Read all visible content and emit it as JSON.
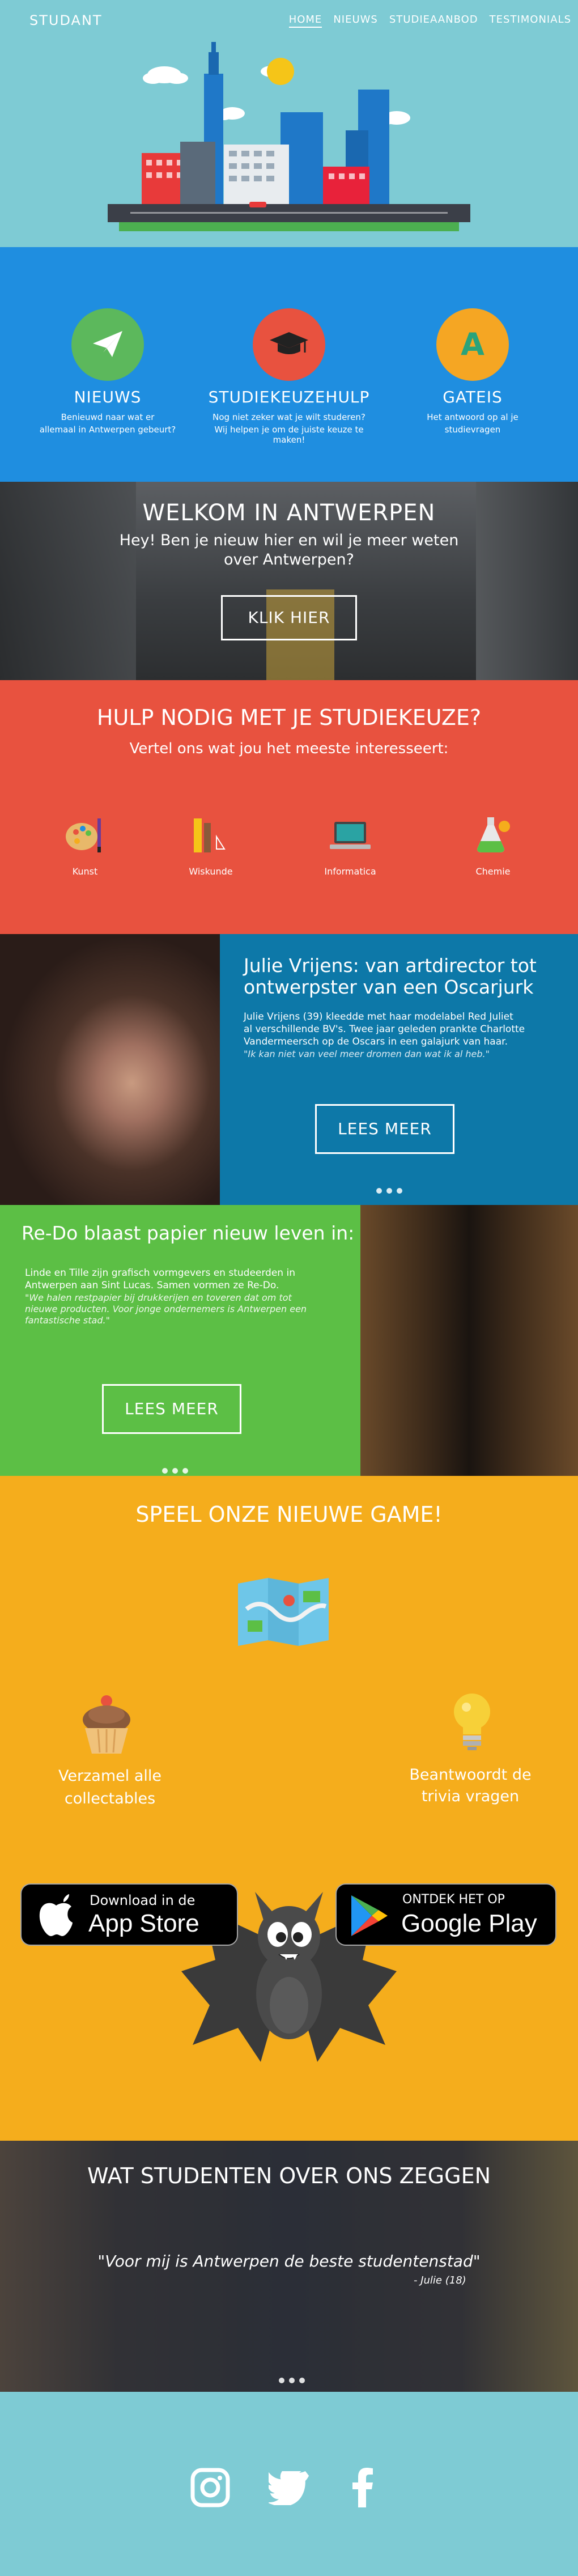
{
  "brand": "STUDANT",
  "nav": [
    "HOME",
    "NIEUWS",
    "STUDIEAANBOD",
    "TESTIMONIALS"
  ],
  "features": [
    {
      "title": "NIEUWS",
      "line1": "Benieuwd naar wat er",
      "line2": "allemaal in Antwerpen gebeurt?",
      "icon": "paper-plane-icon",
      "color": "#5cb85c"
    },
    {
      "title": "STUDIEKEUZEHULP",
      "line1": "Nog niet zeker wat je wilt studeren?",
      "line2": "Wij helpen je om de juiste keuze te maken!",
      "icon": "graduation-cap-icon",
      "color": "#e8523f"
    },
    {
      "title": "GATEIS",
      "line1": "Het antwoord op al je",
      "line2": "studievragen",
      "icon": "letter-a-icon",
      "color": "#f5a623"
    }
  ],
  "welcome": {
    "title": "WELKOM IN ANTWERPEN",
    "line1": "Hey! Ben je nieuw hier en wil je meer weten",
    "line2": "over Antwerpen?",
    "button": "KLIK HIER"
  },
  "help": {
    "title": "HULP NODIG MET JE STUDIEKEUZE?",
    "subtitle": "Vertel ons wat jou het meeste interesseert:",
    "items": [
      {
        "label": "Kunst",
        "icon": "palette-icon"
      },
      {
        "label": "Wiskunde",
        "icon": "ruler-icon"
      },
      {
        "label": "Informatica",
        "icon": "laptop-icon"
      },
      {
        "label": "Chemie",
        "icon": "flask-icon"
      }
    ]
  },
  "story1": {
    "title1": "Julie Vrijens: van artdirector tot",
    "title2": "ontwerpster van een Oscarjurk",
    "p1": "Julie Vrijens (39) kleedde met haar modelabel Red Juliet",
    "p2": "al verschillende BV's. Twee jaar geleden prankte Charlotte",
    "p3": "Vandermeersch op de Oscars in een galajurk van haar.",
    "quote": "\"Ik kan niet van veel meer dromen dan wat ik al heb.\"",
    "button": "LEES MEER"
  },
  "story2": {
    "title": "Re-Do blaast papier nieuw leven in:",
    "p1": "Linde en Tille zijn grafisch vormgevers en studeerden in",
    "p2": "Antwerpen aan Sint Lucas. Samen vormen ze Re-Do.",
    "q1": "\"We halen restpapier bij drukkerijen en toveren dat om tot",
    "q2": "nieuwe producten. Voor jonge ondernemers is Antwerpen een",
    "q3": "fantastische stad.\"",
    "button": "LEES MEER"
  },
  "game": {
    "title": "SPEEL ONZE NIEUWE GAME!",
    "left1": "Verzamel alle",
    "left2": "collectables",
    "right1": "Beantwoordt de",
    "right2": "trivia vragen",
    "appstore_small": "Download in de",
    "appstore_big": "App Store",
    "play_small": "ONTDEK HET OP",
    "play_big": "Google Play"
  },
  "testimonial": {
    "title": "WAT STUDENTEN OVER ONS ZEGGEN",
    "quote": "\"Voor mij is Antwerpen de beste studentenstad\"",
    "author": "- Julie (18)"
  },
  "social": [
    "instagram-icon",
    "twitter-icon",
    "facebook-icon"
  ],
  "colors": {
    "teal": "#7ecbd4",
    "blue": "#1f8ee0",
    "red": "#e8523f",
    "darkblue": "#0d78a8",
    "green": "#5cbf45",
    "orange": "#f5ad1c"
  }
}
